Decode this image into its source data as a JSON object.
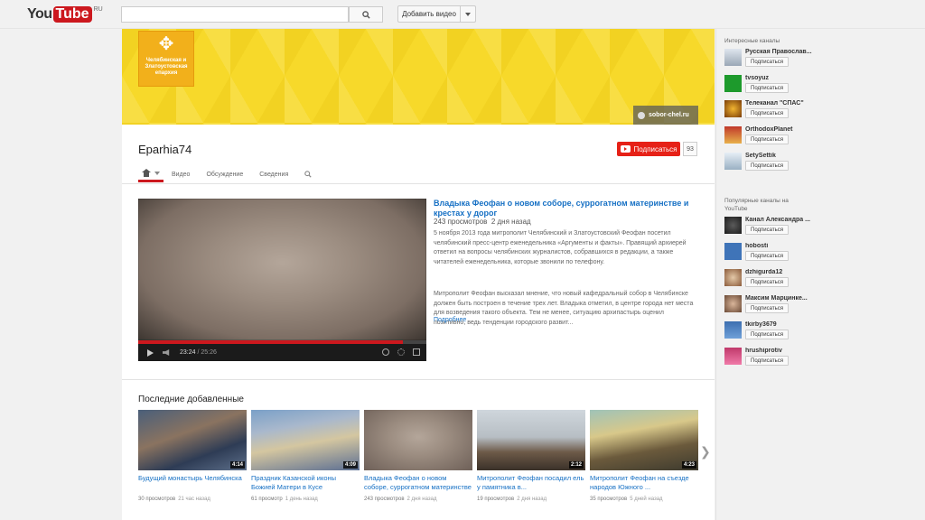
{
  "masthead": {
    "logo_you": "You",
    "logo_tube": "Tube",
    "logo_region": "RU",
    "search_placeholder": "",
    "upload_label": "Добавить видео"
  },
  "channel": {
    "title": "Eparhia74",
    "banner_link": "sobor-chel.ru",
    "logo_text": "Челябинская и Златоустовская епархия",
    "subscribe_label": "Подписаться",
    "subscriber_count": "93",
    "tabs": [
      "Видео",
      "Обсуждение",
      "Сведения"
    ]
  },
  "featured": {
    "title": "Владыка Феофан о новом соборе, суррогатном материнстве и крестах у дорог",
    "views": "243 просмотров",
    "ago": "2 дня назад",
    "description_1": "5 ноября 2013 года митрополит Челябинский и Златоустовский Феофан посетил челябинский пресс-центр еженедельника «Аргументы и факты». Правящий архиерей ответил на вопросы челябинских журналистов, собравшихся в редакции, а также читателей еженедельника, которые звонили по телефону.",
    "description_2": "Митрополит Феофан высказал мнение, что новый кафедральный собор в Челябинске должен быть построен в течение трех лет. Владыка отметил, в центре города нет места для возведения такого объекта. Тем не менее, ситуацию архипастырь оценил позитивно, ведь тенденции городского развит...",
    "more_label": "Подробнее",
    "player": {
      "current_time": "23:24",
      "duration": "25:26",
      "progress_fraction": 0.92
    }
  },
  "recent": {
    "heading": "Последние добавленные",
    "videos": [
      {
        "title": "Будущий монастырь Челябинска",
        "views": "30 просмотров",
        "ago": "21 час назад",
        "duration": "4:14"
      },
      {
        "title": "Праздник Казанской иконы Божией Матери в Кусе",
        "views": "61 просмотр",
        "ago": "1 день назад",
        "duration": "4:09"
      },
      {
        "title": "Владыка Феофан о новом соборе, суррогатном материнстве и...",
        "views": "243 просмотров",
        "ago": "2 дня назад",
        "duration": ""
      },
      {
        "title": "Митрополит Феофан посадил ель у памятника в...",
        "views": "19 просмотров",
        "ago": "2 дня назад",
        "duration": "2:12"
      },
      {
        "title": "Митрополит Феофан на съезде народов Южного ...",
        "views": "35 просмотров",
        "ago": "5 дней назад",
        "duration": "4:23"
      }
    ]
  },
  "sidebar": {
    "interesting_heading": "Интересные каналы",
    "popular_heading": "Популярные каналы на YouTube",
    "subscribe_label": "Подписаться",
    "interesting": [
      {
        "name": "Русская Православ..."
      },
      {
        "name": "tvsoyuz"
      },
      {
        "name": "Телеканал \"СПАС\""
      },
      {
        "name": "OrthodoxPlanet"
      },
      {
        "name": "SetySettik"
      }
    ],
    "popular": [
      {
        "name": "Канал Александра ..."
      },
      {
        "name": "hobosti"
      },
      {
        "name": "dzhigurda12"
      },
      {
        "name": "Максим Марцинке..."
      },
      {
        "name": "tkirby3679"
      },
      {
        "name": "hrushiprotiv"
      }
    ]
  }
}
